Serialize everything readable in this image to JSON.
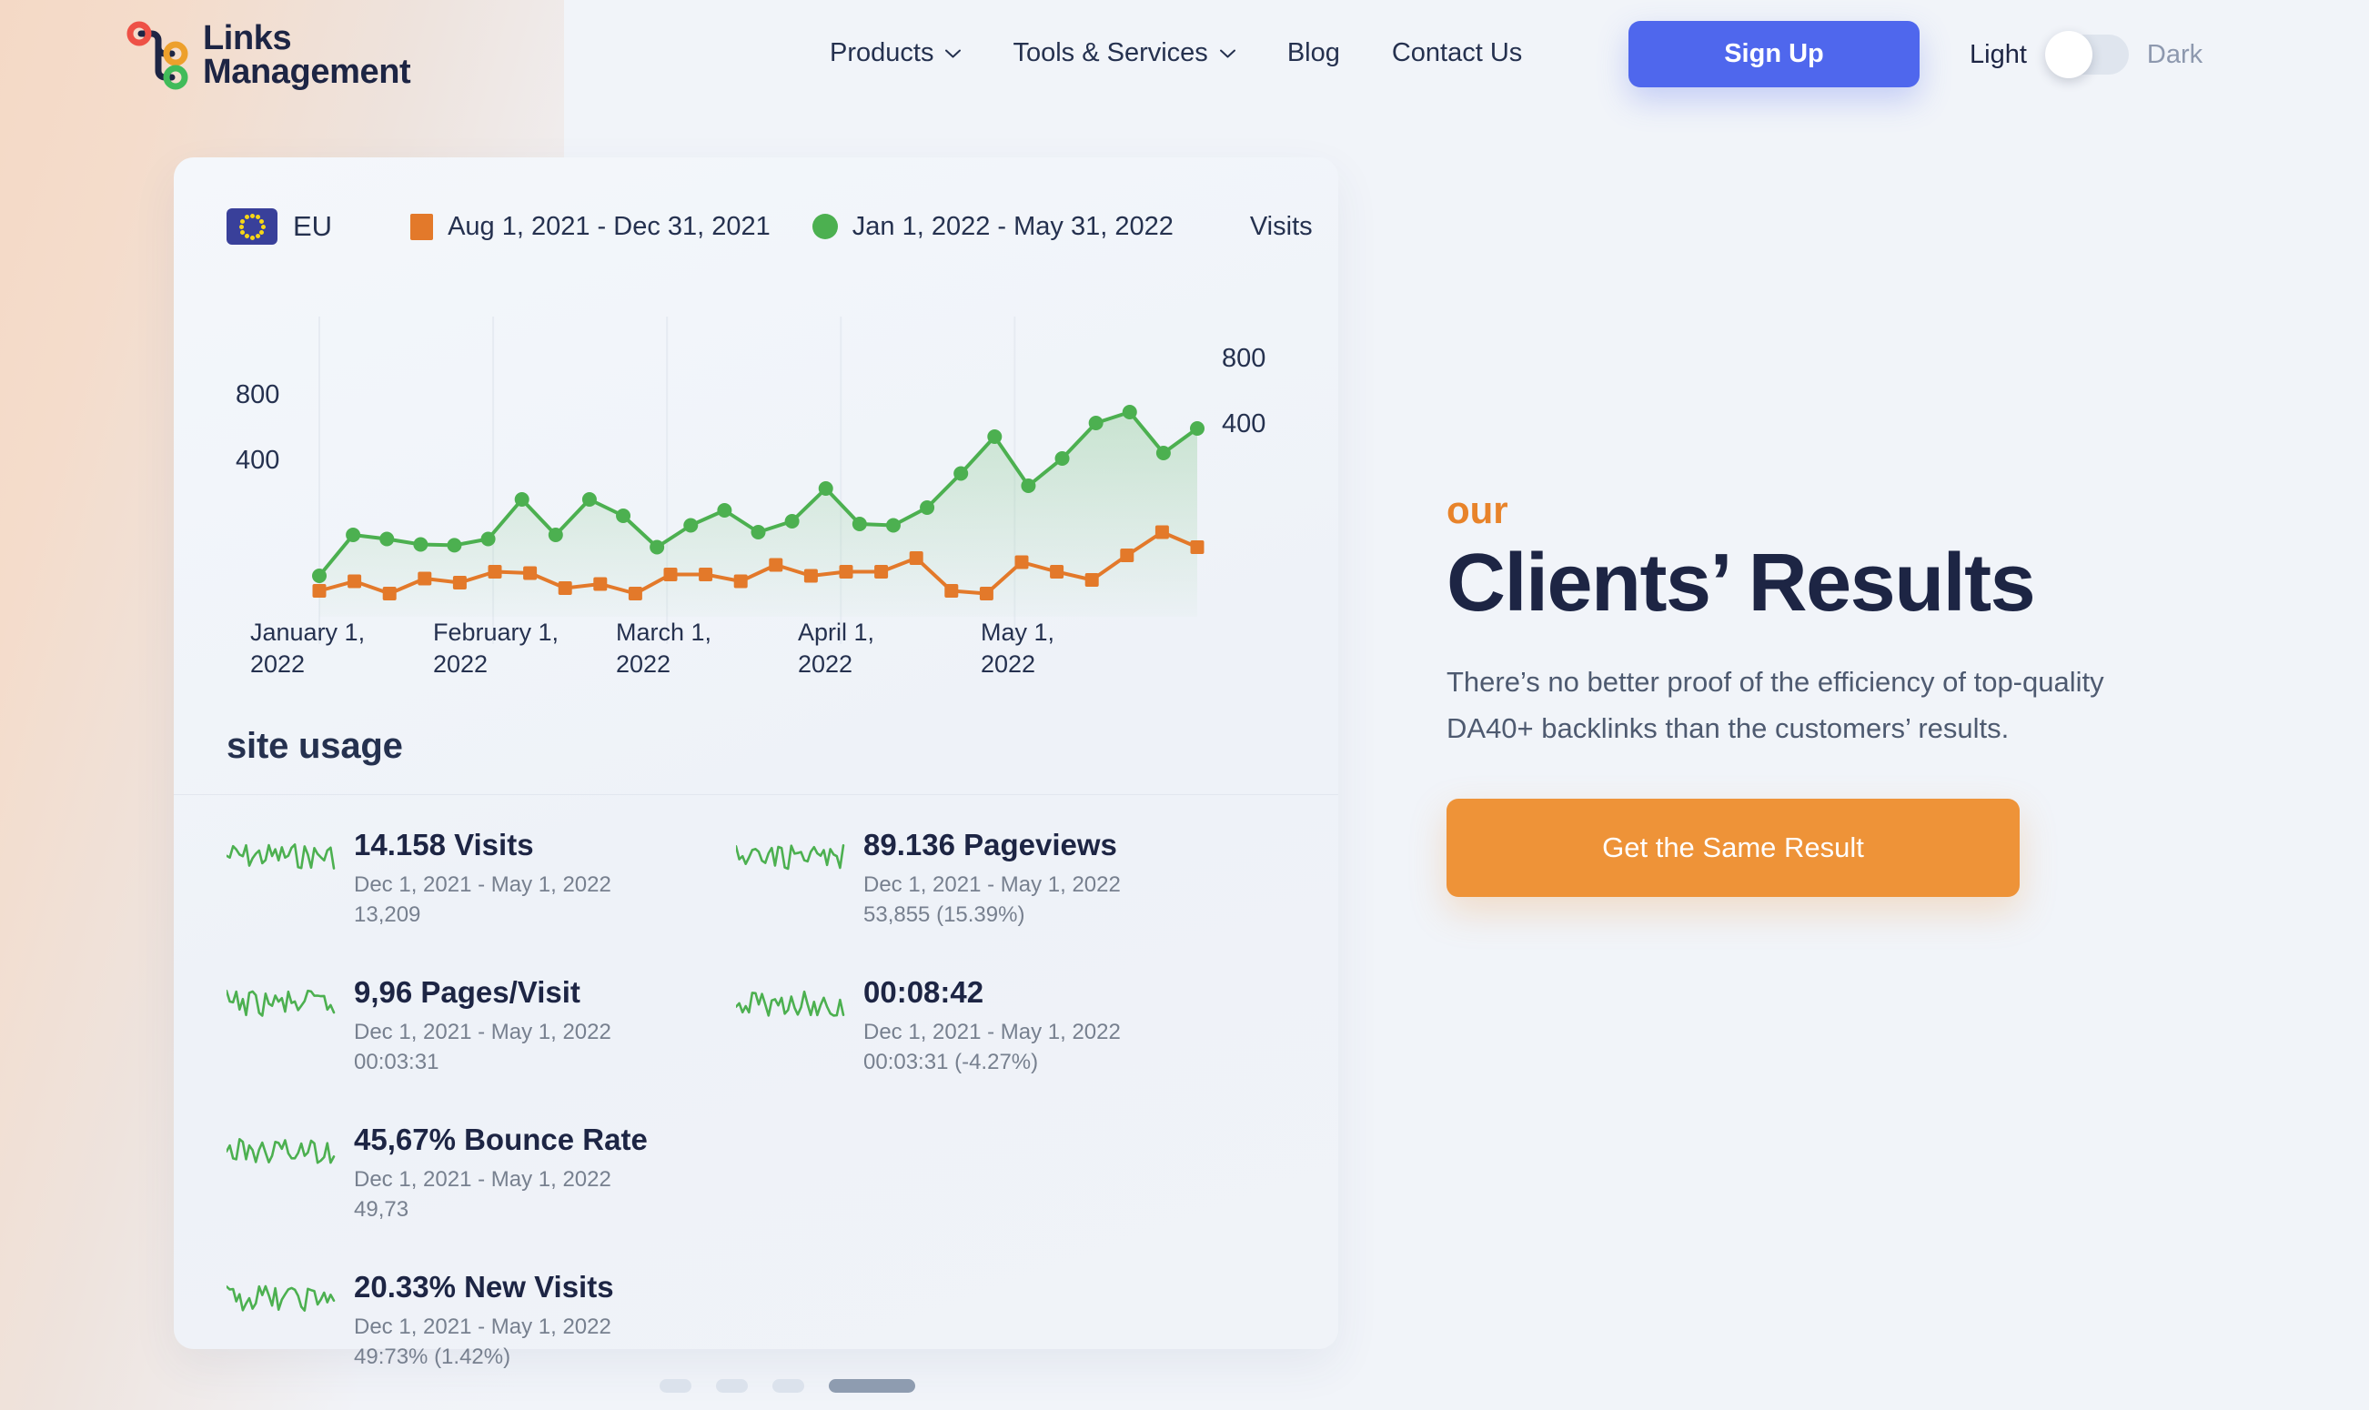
{
  "brand": {
    "name_line1": "Links",
    "name_line2": "Management"
  },
  "nav": {
    "items": [
      {
        "label": "Products",
        "has_dropdown": true,
        "icon": "chevron-down-icon"
      },
      {
        "label": "Tools & Services",
        "has_dropdown": true,
        "icon": "chevron-down-icon"
      },
      {
        "label": "Blog",
        "has_dropdown": false
      },
      {
        "label": "Contact Us",
        "has_dropdown": false
      }
    ],
    "signup_label": "Sign Up",
    "theme": {
      "light_label": "Light",
      "dark_label": "Dark",
      "active": "Light"
    }
  },
  "card": {
    "region_label": "EU",
    "region_icon": "eu-flag-icon",
    "legend": [
      {
        "label": "Aug 1, 2021 - Dec 31, 2021",
        "color": "#e3792a",
        "marker": "square"
      },
      {
        "label": "Jan 1, 2022 - May 31, 2022",
        "color": "#4cb050",
        "marker": "circle"
      }
    ],
    "metric_label": "Visits",
    "section_title": "site usage"
  },
  "chart_data": {
    "type": "line",
    "title": "",
    "xlabel": "",
    "ylabel": "Visits",
    "ylim": [
      0,
      1000
    ],
    "yticks": [
      400,
      800
    ],
    "ytick_labels_left": [
      "800",
      "400"
    ],
    "ytick_labels_right": [
      "800",
      "400"
    ],
    "grid": "vertical-only",
    "legend_position": "top",
    "x_tick_labels": [
      "January 1,\n2022",
      "February 1,\n2022",
      "March 1,\n2022",
      "April 1,\n2022",
      "May 1,\n2022"
    ],
    "series": [
      {
        "name": "Jan 1, 2022 - May 31, 2022",
        "color": "#4cb050",
        "marker": "circle",
        "fill": true,
        "values": [
          150,
          300,
          285,
          265,
          262,
          285,
          430,
          300,
          430,
          370,
          255,
          335,
          390,
          310,
          350,
          470,
          340,
          335,
          400,
          525,
          660,
          480,
          580,
          710,
          750,
          600,
          690
        ]
      },
      {
        "name": "Aug 1, 2021 - Dec 31, 2021",
        "color": "#e3792a",
        "marker": "square",
        "fill": false,
        "values": [
          95,
          130,
          85,
          140,
          125,
          165,
          160,
          105,
          120,
          85,
          155,
          155,
          130,
          190,
          150,
          165,
          165,
          215,
          95,
          85,
          200,
          165,
          135,
          225,
          310,
          255
        ]
      }
    ]
  },
  "metrics": {
    "left": [
      {
        "title": "14.158 Visits",
        "range": "Dec 1, 2021 - May 1, 2022",
        "sub": "13,209",
        "icon": "sparkline-icon"
      },
      {
        "title": "9,96 Pages/Visit",
        "range": "Dec 1, 2021 - May 1, 2022",
        "sub": "00:03:31",
        "icon": "sparkline-icon"
      },
      {
        "title": "45,67% Bounce Rate",
        "range": "Dec 1, 2021 - May 1, 2022",
        "sub": "49,73",
        "icon": "sparkline-icon"
      },
      {
        "title": "20.33% New Visits",
        "range": "Dec 1, 2021 - May 1, 2022",
        "sub": "49:73% (1.42%)",
        "icon": "sparkline-icon"
      }
    ],
    "right": [
      {
        "title": "89.136 Pageviews",
        "range": "Dec 1, 2021 - May 1, 2022",
        "sub": "53,855 (15.39%)",
        "icon": "sparkline-icon"
      },
      {
        "title": "00:08:42",
        "range": "Dec 1, 2021 - May 1, 2022",
        "sub": "00:03:31 (-4.27%)",
        "icon": "sparkline-icon"
      }
    ]
  },
  "carousel": {
    "count": 4,
    "active_index": 3
  },
  "hero": {
    "kicker": "our",
    "title": "Clients’ Results",
    "text": "There’s no better proof of the efficiency of top-quality DA40+ backlinks than the customers’ results.",
    "cta_label": "Get the Same Result"
  },
  "colors": {
    "accent_blue": "#4f67ed",
    "accent_orange": "#ee9338",
    "series_green": "#4cb050",
    "series_orange": "#e3792a",
    "text_dark": "#1d2544"
  }
}
